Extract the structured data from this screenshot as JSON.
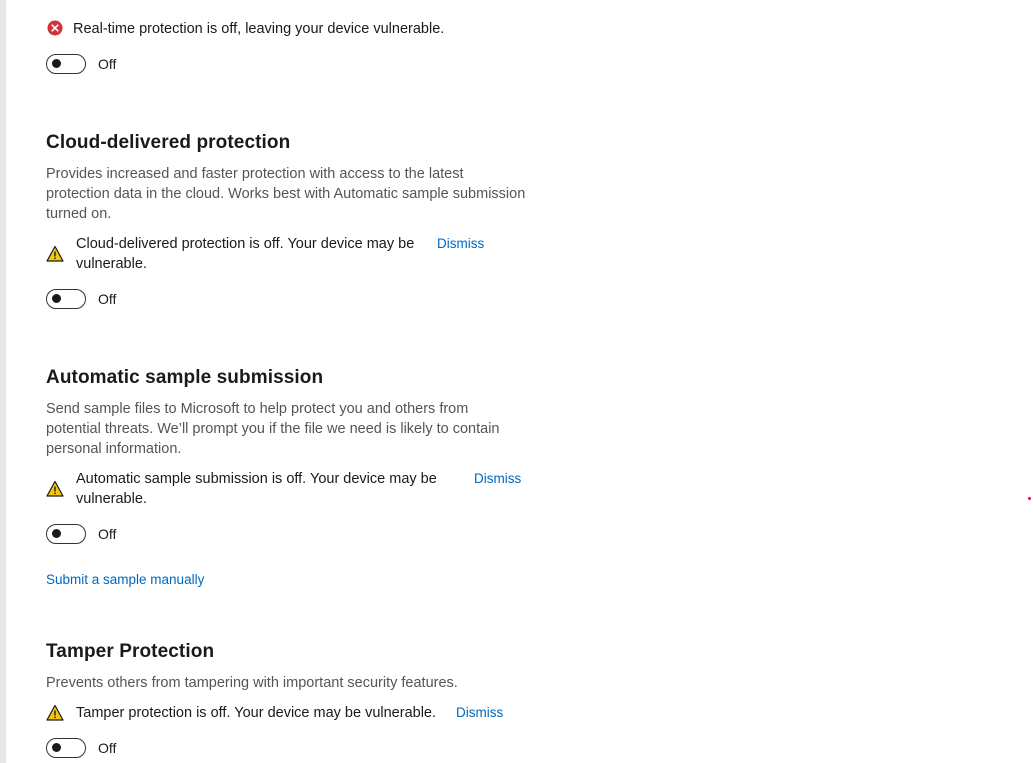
{
  "realtime": {
    "status_text": "Real-time protection is off, leaving your device vulnerable.",
    "toggle_label": "Off",
    "status_icon": "error-circle-icon"
  },
  "cloud": {
    "title": "Cloud-delivered protection",
    "description": "Provides increased and faster protection with access to the latest protection data in the cloud. Works best with Automatic sample submission turned on.",
    "status_text": "Cloud-delivered protection is off. Your device may be vulnerable.",
    "dismiss_label": "Dismiss",
    "toggle_label": "Off",
    "status_icon": "warning-icon"
  },
  "sample": {
    "title": "Automatic sample submission",
    "description": "Send sample files to Microsoft to help protect you and others from potential threats. We’ll prompt you if the file we need is likely to contain personal information.",
    "status_text": "Automatic sample submission is off. Your device may be vulnerable.",
    "dismiss_label": "Dismiss",
    "toggle_label": "Off",
    "manual_link": "Submit a sample manually",
    "status_icon": "warning-icon"
  },
  "tamper": {
    "title": "Tamper Protection",
    "description": "Prevents others from tampering with important security features.",
    "status_text": "Tamper protection is off. Your device may be vulnerable.",
    "dismiss_label": "Dismiss",
    "toggle_label": "Off",
    "status_icon": "warning-icon"
  },
  "colors": {
    "link": "#0067c0",
    "error": "#d13438",
    "warning": "#f2c80f",
    "rail": "#e6e6e6"
  }
}
